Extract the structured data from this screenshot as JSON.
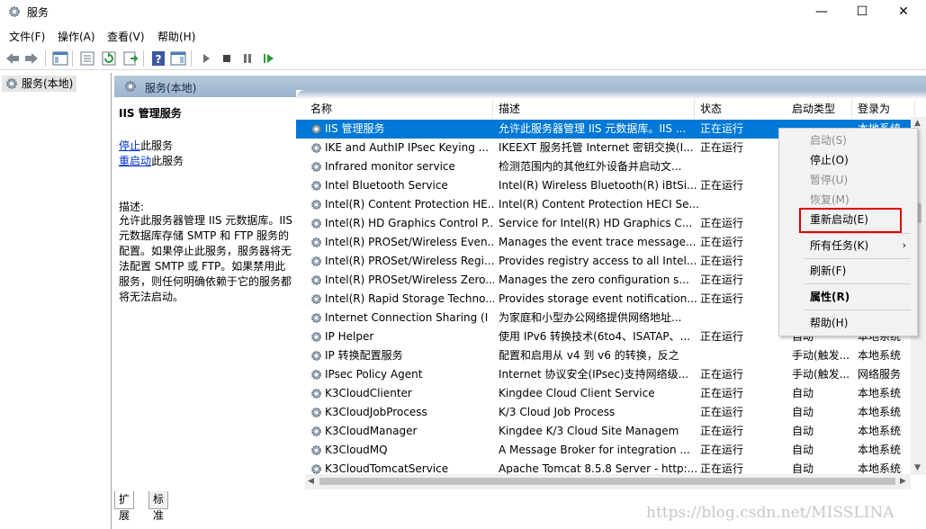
{
  "window": {
    "title": "服务",
    "controls": {
      "minimize": "—",
      "maximize": "☐",
      "close": "✕"
    }
  },
  "menubar": {
    "items": [
      "文件(F)",
      "操作(A)",
      "查看(V)",
      "帮助(H)"
    ]
  },
  "toolbar": {
    "icons": [
      "back-icon",
      "forward-icon",
      "show-console-tree-icon",
      "properties-icon",
      "refresh-icon",
      "export-list-icon",
      "help-icon",
      "action-pane-icon",
      "start-service-icon",
      "stop-service-icon",
      "pause-service-icon",
      "restart-service-icon"
    ]
  },
  "tree": {
    "root_label": "服务(本地)"
  },
  "panel": {
    "header_label": "服务(本地)"
  },
  "description_pane": {
    "title": "IIS 管理服务",
    "stop_link": "停止",
    "stop_suffix": "此服务",
    "restart_link": "重启动",
    "restart_suffix": "此服务",
    "desc_label": "描述:",
    "desc_text": "允许此服务器管理 IIS 元数据库。IIS 元数据库存储 SMTP 和 FTP 服务的配置。如果停止此服务，服务器将无法配置 SMTP 或 FTP。如果禁用此服务，则任何明确依赖于它的服务都将无法启动。"
  },
  "columns": {
    "name": "名称",
    "desc": "描述",
    "status": "状态",
    "startup": "启动类型",
    "logon": "登录为"
  },
  "services": [
    {
      "name": "IIS 管理服务",
      "desc": "允许此服务器管理 IIS 元数据库。IIS ...",
      "status": "正在运行",
      "startup": "",
      "logon": "本地系统",
      "selected": true
    },
    {
      "name": "IKE and AuthIP IPsec Keying ...",
      "desc": "IKEEXT 服务托管 Internet 密钥交换(I...",
      "status": "正在运行",
      "startup": "",
      "logon": ""
    },
    {
      "name": "Infrared monitor service",
      "desc": "检测范围内的其他红外设备并启动文...",
      "status": "",
      "startup": "",
      "logon": ""
    },
    {
      "name": "Intel Bluetooth Service",
      "desc": "Intel(R) Wireless Bluetooth(R) iBtSi...",
      "status": "正在运行",
      "startup": "",
      "logon": ""
    },
    {
      "name": "Intel(R) Content Protection HE...",
      "desc": "Intel(R) Content Protection HECI Se...",
      "status": "",
      "startup": "",
      "logon": ""
    },
    {
      "name": "Intel(R) HD Graphics Control P...",
      "desc": "Service for Intel(R) HD Graphics C...",
      "status": "正在运行",
      "startup": "",
      "logon": ""
    },
    {
      "name": "Intel(R) PROSet/Wireless Even...",
      "desc": "Manages the event trace message...",
      "status": "正在运行",
      "startup": "",
      "logon": ""
    },
    {
      "name": "Intel(R) PROSet/Wireless Regi...",
      "desc": "Provides registry access to all Intel...",
      "status": "正在运行",
      "startup": "",
      "logon": ""
    },
    {
      "name": "Intel(R) PROSet/Wireless Zero...",
      "desc": "Manages the zero configuration s...",
      "status": "正在运行",
      "startup": "",
      "logon": ""
    },
    {
      "name": "Intel(R) Rapid Storage Techno...",
      "desc": "Provides storage event notification...",
      "status": "正在运行",
      "startup": "",
      "logon": ""
    },
    {
      "name": "Internet Connection Sharing (I",
      "desc": "为家庭和小型办公网络提供网络地址...",
      "status": "",
      "startup": "",
      "logon": ""
    },
    {
      "name": "IP Helper",
      "desc": "使用 IPv6 转换技术(6to4、ISATAP、...",
      "status": "正在运行",
      "startup": "自动",
      "logon": "本地系统"
    },
    {
      "name": "IP 转换配置服务",
      "desc": "配置和启用从 v4 到 v6 的转换，反之",
      "status": "",
      "startup": "手动(触发...",
      "logon": "本地系统"
    },
    {
      "name": "IPsec Policy Agent",
      "desc": "Internet 协议安全(IPsec)支持网络级...",
      "status": "正在运行",
      "startup": "手动(触发...",
      "logon": "网络服务"
    },
    {
      "name": "K3CloudClienter",
      "desc": "Kingdee Cloud Client Service",
      "status": "正在运行",
      "startup": "自动",
      "logon": "本地系统"
    },
    {
      "name": "K3CloudJobProcess",
      "desc": "K/3 Cloud Job Process",
      "status": "正在运行",
      "startup": "自动",
      "logon": "本地系统"
    },
    {
      "name": "K3CloudManager",
      "desc": "Kingdee K/3 Cloud Site Managem",
      "status": "正在运行",
      "startup": "自动",
      "logon": "本地系统"
    },
    {
      "name": "K3CloudMQ",
      "desc": "A Message Broker for integration ...",
      "status": "正在运行",
      "startup": "自动",
      "logon": "本地系统"
    },
    {
      "name": "K3CloudTomcatService",
      "desc": "Apache Tomcat 8.5.8 Server - http:...",
      "status": "正在运行",
      "startup": "自动",
      "logon": "本地系统"
    }
  ],
  "context_menu": {
    "start": "启动(S)",
    "stop": "停止(O)",
    "pause": "暂停(U)",
    "resume": "恢复(M)",
    "restart": "重新启动(E)",
    "all_tasks": "所有任务(K)",
    "refresh": "刷新(F)",
    "properties": "属性(R)",
    "help": "帮助(H)"
  },
  "tabs": {
    "extended": "扩展",
    "standard": "标准"
  },
  "watermark": "https://blog.csdn.net/MISSLINA",
  "colors": {
    "selection": "#0078d7",
    "highlight_box": "#e00000",
    "link": "#0033cc"
  }
}
